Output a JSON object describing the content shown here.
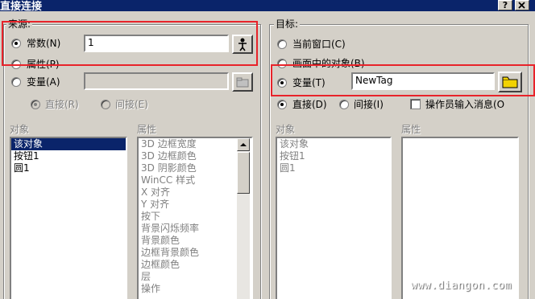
{
  "window": {
    "title": "直接连接",
    "help_glyph": "?"
  },
  "source": {
    "legend": "来源:",
    "constant_label": "常数(N)",
    "constant_value": "1",
    "property_label": "属性(P)",
    "variable_label": "变量(A)",
    "direct_label": "直接(R)",
    "indirect_label": "间接(E)",
    "object_header": "对象",
    "property_header": "属性",
    "objects": [
      "该对象",
      "按钮1",
      "圆1"
    ],
    "properties": [
      "3D 边框宽度",
      "3D 边框颜色",
      "3D 阴影颜色",
      "WinCC 样式",
      "X 对齐",
      "Y 对齐",
      "按下",
      "背景闪烁频率",
      "背景颜色",
      "边框背景颜色",
      "边框颜色",
      "层",
      "操作"
    ]
  },
  "target": {
    "legend": "目标:",
    "current_window_label": "当前窗口(C)",
    "screen_object_label": "画面中的对象(B)",
    "variable_label": "变量(T)",
    "variable_value": "NewTag",
    "direct_label": "直接(D)",
    "indirect_label": "间接(I)",
    "operator_msg_label": "操作员输入消息(O",
    "object_header": "对象",
    "property_header": "属性",
    "objects": [
      "该对象",
      "按钮1",
      "圆1"
    ]
  },
  "watermark": "www.diangon.com",
  "colors": {
    "title_bar": "#0a246a",
    "dialog_bg": "#d4d0c8",
    "highlight": "#e8232a",
    "folder": "#f2d200"
  },
  "icons": {
    "tag_picker": "person-tag-icon",
    "folder_browse": "folder-icon",
    "close": "close-icon"
  }
}
